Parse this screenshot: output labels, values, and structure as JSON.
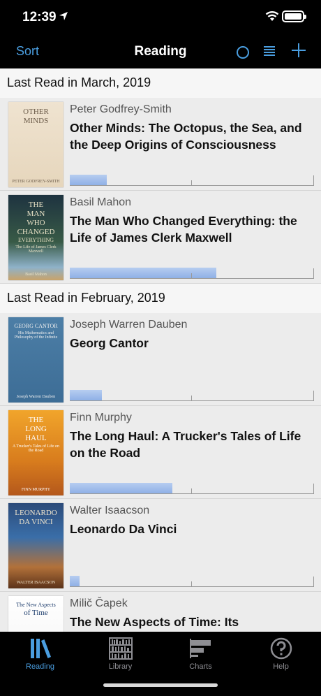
{
  "status": {
    "time": "12:39"
  },
  "nav": {
    "sort_label": "Sort",
    "title": "Reading"
  },
  "colors": {
    "accent": "#4a9ee0",
    "progress": "#9ab8ea",
    "background": "#efefef",
    "bar": "#000000"
  },
  "sections": [
    {
      "header": "Last Read in March, 2019",
      "books": [
        {
          "author": "Peter Godfrey-Smith",
          "title": "Other Minds: The Octopus, the Sea, and the Deep Origins of Consciousness",
          "progress": 0.15,
          "cover": "octopus"
        },
        {
          "author": "Basil Mahon",
          "title": "The Man Who Changed Everything: the Life of James Clerk Maxwell",
          "progress": 0.6,
          "cover": "maxwell"
        }
      ]
    },
    {
      "header": "Last Read in February, 2019",
      "books": [
        {
          "author": "Joseph Warren Dauben",
          "title": "Georg Cantor",
          "progress": 0.13,
          "cover": "cantor"
        },
        {
          "author": "Finn Murphy",
          "title": "The Long Haul: A Trucker's Tales of Life on the Road",
          "progress": 0.42,
          "cover": "longhaul"
        },
        {
          "author": "Walter Isaacson",
          "title": "Leonardo Da Vinci",
          "progress": 0.04,
          "cover": "davinci"
        },
        {
          "author": "Milič Čapek",
          "title": "The New Aspects of Time: Its",
          "progress": 0.0,
          "cover": "time"
        }
      ]
    }
  ],
  "covers": {
    "octopus": {
      "lines": [
        "OTHER",
        "MINDS"
      ],
      "footer": "PETER GODFREY-SMITH"
    },
    "maxwell": {
      "lines": [
        "THE",
        "MAN",
        "WHO",
        "CHANGED",
        "EVERYTHING"
      ],
      "sub": "The Life of James Clerk Maxwell",
      "footer": "Basil Mahon"
    },
    "cantor": {
      "lines": [
        "GEORG CANTOR"
      ],
      "sub": "His Mathematics and Philosophy of the Infinite",
      "footer": "Joseph Warren Dauben"
    },
    "longhaul": {
      "lines": [
        "THE",
        "LONG",
        "HAUL"
      ],
      "sub": "A Trucker's Tales of Life on the Road",
      "footer": "FINN MURPHY"
    },
    "davinci": {
      "lines": [
        "LEONARDO",
        "DA VINCI"
      ],
      "footer": "WALTER ISAACSON"
    },
    "time": {
      "lines": [
        "The New Aspects",
        "of Time"
      ]
    }
  },
  "tabs": [
    {
      "label": "Reading",
      "icon": "books-icon",
      "active": true
    },
    {
      "label": "Library",
      "icon": "library-icon",
      "active": false
    },
    {
      "label": "Charts",
      "icon": "charts-icon",
      "active": false
    },
    {
      "label": "Help",
      "icon": "help-icon",
      "active": false
    }
  ]
}
